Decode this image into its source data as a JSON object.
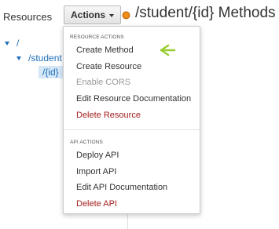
{
  "sidebar": {
    "heading": "Resources",
    "tree": [
      {
        "label": "/"
      },
      {
        "label": "/student"
      },
      {
        "label": "/{id}"
      }
    ]
  },
  "toolbar": {
    "actions_label": "Actions"
  },
  "header": {
    "title": "/student/{id} Methods"
  },
  "dropdown": {
    "resource_section": {
      "header": "RESOURCE ACTIONS",
      "items": [
        {
          "label": "Create Method",
          "state": "normal"
        },
        {
          "label": "Create Resource",
          "state": "normal"
        },
        {
          "label": "Enable CORS",
          "state": "disabled"
        },
        {
          "label": "Edit Resource Documentation",
          "state": "normal"
        },
        {
          "label": "Delete Resource",
          "state": "danger"
        }
      ]
    },
    "api_section": {
      "header": "API ACTIONS",
      "items": [
        {
          "label": "Deploy API",
          "state": "normal"
        },
        {
          "label": "Import API",
          "state": "normal"
        },
        {
          "label": "Edit API Documentation",
          "state": "normal"
        },
        {
          "label": "Delete API",
          "state": "danger"
        }
      ]
    }
  },
  "colors": {
    "link": "#1f6fb8",
    "danger": "#a4201f",
    "disabled": "#999999",
    "status_dot": "#f0901a",
    "annotation_arrow": "#9acd32"
  },
  "icons": {
    "status": "orange-dot-icon",
    "annotation": "green-arrow-icon"
  }
}
